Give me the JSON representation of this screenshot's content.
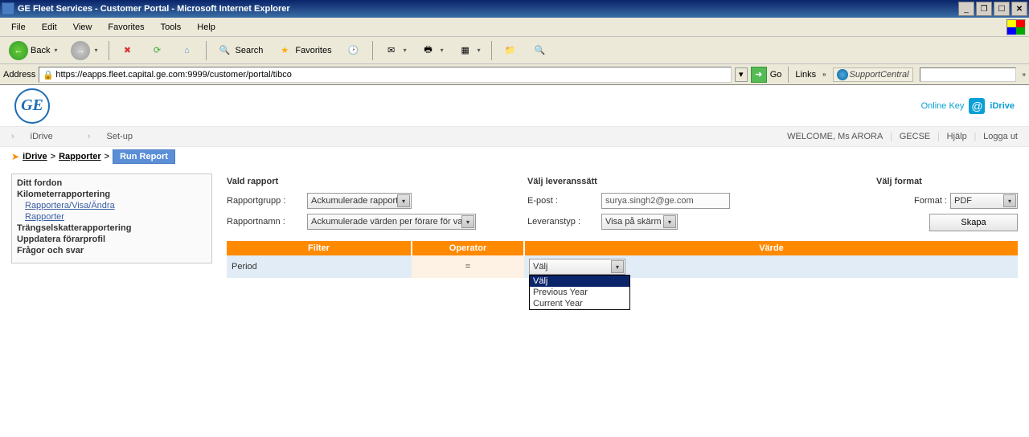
{
  "window": {
    "title": "GE Fleet Services - Customer Portal - Microsoft Internet Explorer"
  },
  "menubar": {
    "file": "File",
    "edit": "Edit",
    "view": "View",
    "favorites": "Favorites",
    "tools": "Tools",
    "help": "Help"
  },
  "toolbar": {
    "back": "Back",
    "search": "Search",
    "favorites": "Favorites"
  },
  "address": {
    "label": "Address",
    "url": "https://eapps.fleet.capital.ge.com:9999/customer/portal/tibco",
    "go": "Go",
    "links": "Links",
    "support": "SupportCentral"
  },
  "brand": {
    "onlinekey": "Online Key",
    "idrive": "iDrive"
  },
  "crumb": {
    "idrive": "iDrive",
    "setup": "Set-up",
    "welcome": "WELCOME, Ms ARORA",
    "gecse": "GECSE",
    "help": "Hjälp",
    "logout": "Logga ut"
  },
  "bc": {
    "idrive": "iDrive",
    "reports": "Rapporter",
    "run": "Run Report"
  },
  "sidebar": {
    "i0": "Ditt fordon",
    "i1": "Kilometerrapportering",
    "i1a": "Rapportera/Visa/Ändra",
    "i1b": "Rapporter",
    "i2": "Trängselskatterapportering",
    "i3": "Uppdatera förarprofil",
    "i4": "Frågor och svar"
  },
  "form": {
    "h_report": "Vald rapport",
    "grp_lbl": "Rapportgrupp :",
    "grp_val": "Ackumulerade rapport",
    "name_lbl": "Rapportnamn :",
    "name_val": "Ackumulerade värden per förare för valt",
    "h_delivery": "Välj leveranssätt",
    "email_lbl": "E-post :",
    "email_val": "surya.singh2@ge.com",
    "dtype_lbl": "Leveranstyp :",
    "dtype_val": "Visa på skärm",
    "h_format": "Välj format",
    "fmt_lbl": "Format :",
    "fmt_val": "PDF",
    "create": "Skapa"
  },
  "table": {
    "h_filter": "Filter",
    "h_op": "Operator",
    "h_val": "Värde",
    "row1_filter": "Period",
    "row1_op": "=",
    "row1_val": "Välj"
  },
  "dropdown": {
    "o0": "Välj",
    "o1": "Previous Year",
    "o2": "Current Year"
  }
}
